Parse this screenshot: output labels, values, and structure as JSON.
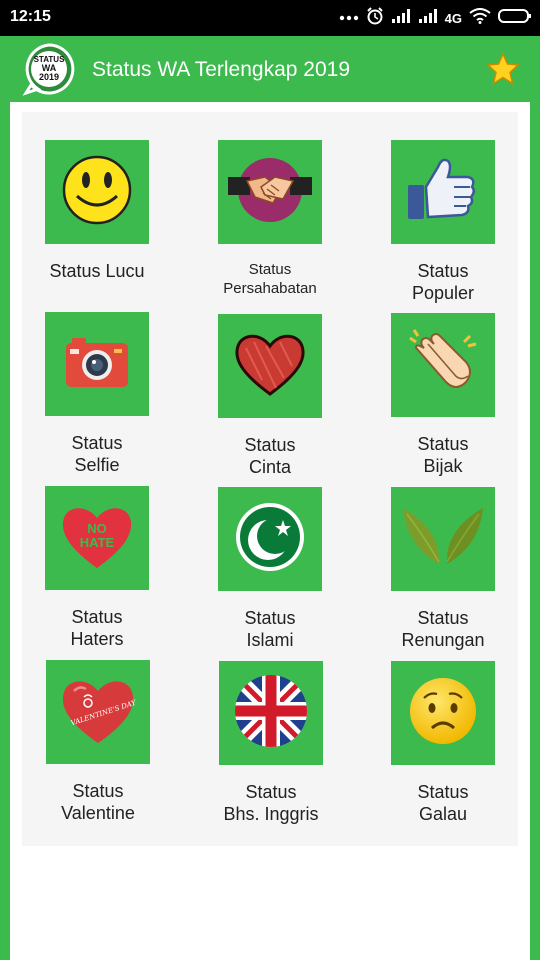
{
  "status_bar": {
    "time": "12:15",
    "network": "4G",
    "icons": [
      "more-dots-icon",
      "alarm-icon",
      "signal-icon",
      "signal-icon",
      "wifi-icon",
      "battery-icon"
    ]
  },
  "app_bar": {
    "logo_line1": "STATUS",
    "logo_line2": "WA",
    "logo_line3": "2019",
    "title": "Status WA Terlengkap 2019",
    "star_icon": "star-icon"
  },
  "colors": {
    "primary": "#3dba4e",
    "panel": "#f5f5f5",
    "text": "#222222"
  },
  "categories": [
    {
      "line1": "Status Lucu",
      "line2": "",
      "icon": "smiley-face-icon"
    },
    {
      "line1": "Status",
      "line2": "Persahabatan",
      "icon": "handshake-icon"
    },
    {
      "line1": "Status",
      "line2": "Populer",
      "icon": "thumbs-up-icon"
    },
    {
      "line1": "Status",
      "line2": "Selfie",
      "icon": "camera-icon"
    },
    {
      "line1": "Status",
      "line2": "Cinta",
      "icon": "heart-icon"
    },
    {
      "line1": "Status",
      "line2": "Bijak",
      "icon": "clapping-hands-icon"
    },
    {
      "line1": "Status",
      "line2": "Haters",
      "icon": "no-hate-heart-icon",
      "icon_text1": "NO",
      "icon_text2": "HATE"
    },
    {
      "line1": "Status",
      "line2": "Islami",
      "icon": "crescent-star-icon"
    },
    {
      "line1": "Status",
      "line2": "Renungan",
      "icon": "leaves-icon"
    },
    {
      "line1": "Status",
      "line2": "Valentine",
      "icon": "valentine-heart-icon",
      "icon_text1": "VALENTINE'S DAY"
    },
    {
      "line1": "Status",
      "line2": "Bhs. Inggris",
      "icon": "uk-flag-icon"
    },
    {
      "line1": "Status",
      "line2": "Galau",
      "icon": "sad-face-icon"
    }
  ]
}
